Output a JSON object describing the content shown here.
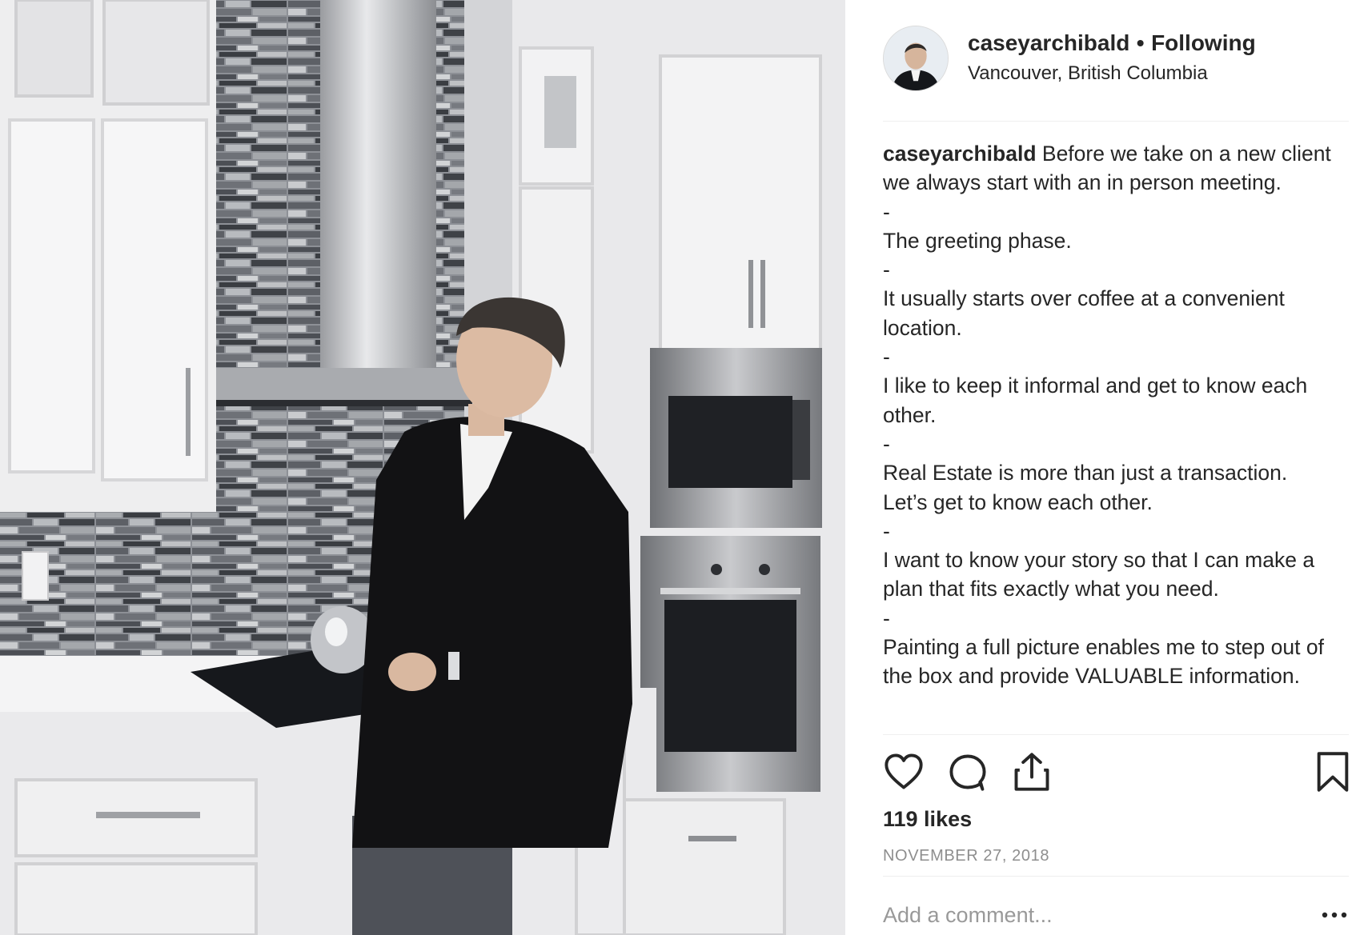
{
  "post": {
    "username": "caseyarchibald",
    "separator": "•",
    "follow_status": "Following",
    "location": "Vancouver, British Columbia",
    "caption_lines": [
      "Before we take on a new client we always start with an in person meeting.",
      "-",
      "The greeting phase.",
      "-",
      "It usually starts over coffee at a convenient location.",
      "-",
      "I like to keep it informal and get to know each other.",
      "-",
      "Real Estate is more than just a transaction.",
      "Let’s get to know each other.",
      "-",
      "I want to know your story so that I can make a plan that fits exactly what you need.",
      "-",
      "Painting a full picture enables me to step out of the box and provide VALUABLE information."
    ],
    "likes": "119 likes",
    "date": "NOVEMBER 27, 2018",
    "comment_placeholder": "Add a comment..."
  },
  "icons": {
    "like": "heart-icon",
    "comment": "comment-icon",
    "share": "share-icon",
    "save": "bookmark-icon",
    "more": "more-options-icon"
  },
  "colors": {
    "text": "#262626",
    "muted": "#8e8e8e",
    "divider": "#efefef"
  }
}
